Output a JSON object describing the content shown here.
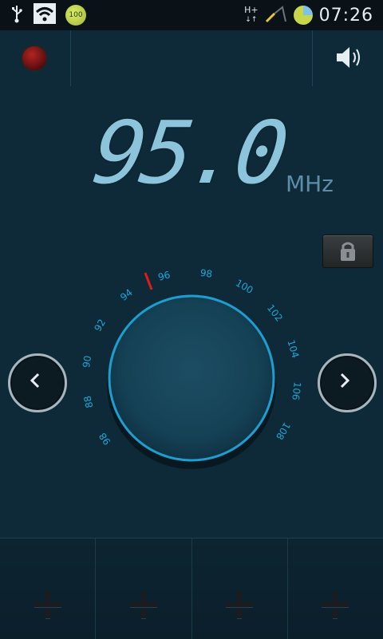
{
  "statusbar": {
    "battery_badge": "100",
    "network_label": "H+",
    "time": "07:26",
    "icons": [
      "usb-icon",
      "wifi-icon",
      "battery-badge-icon",
      "network-hplus-icon",
      "signal-icon",
      "battery-icon"
    ]
  },
  "radio": {
    "frequency": "95.0",
    "unit": "MHz",
    "dial_labels": [
      "98",
      "88",
      "90",
      "92",
      "94",
      "96",
      "98",
      "100",
      "102",
      "104",
      "106",
      "108"
    ]
  },
  "favorites": [
    "+",
    "+",
    "+",
    "+"
  ],
  "colors": {
    "background": "#0e2a38",
    "accent": "#1aa7d8",
    "needle": "#e11b1b"
  }
}
